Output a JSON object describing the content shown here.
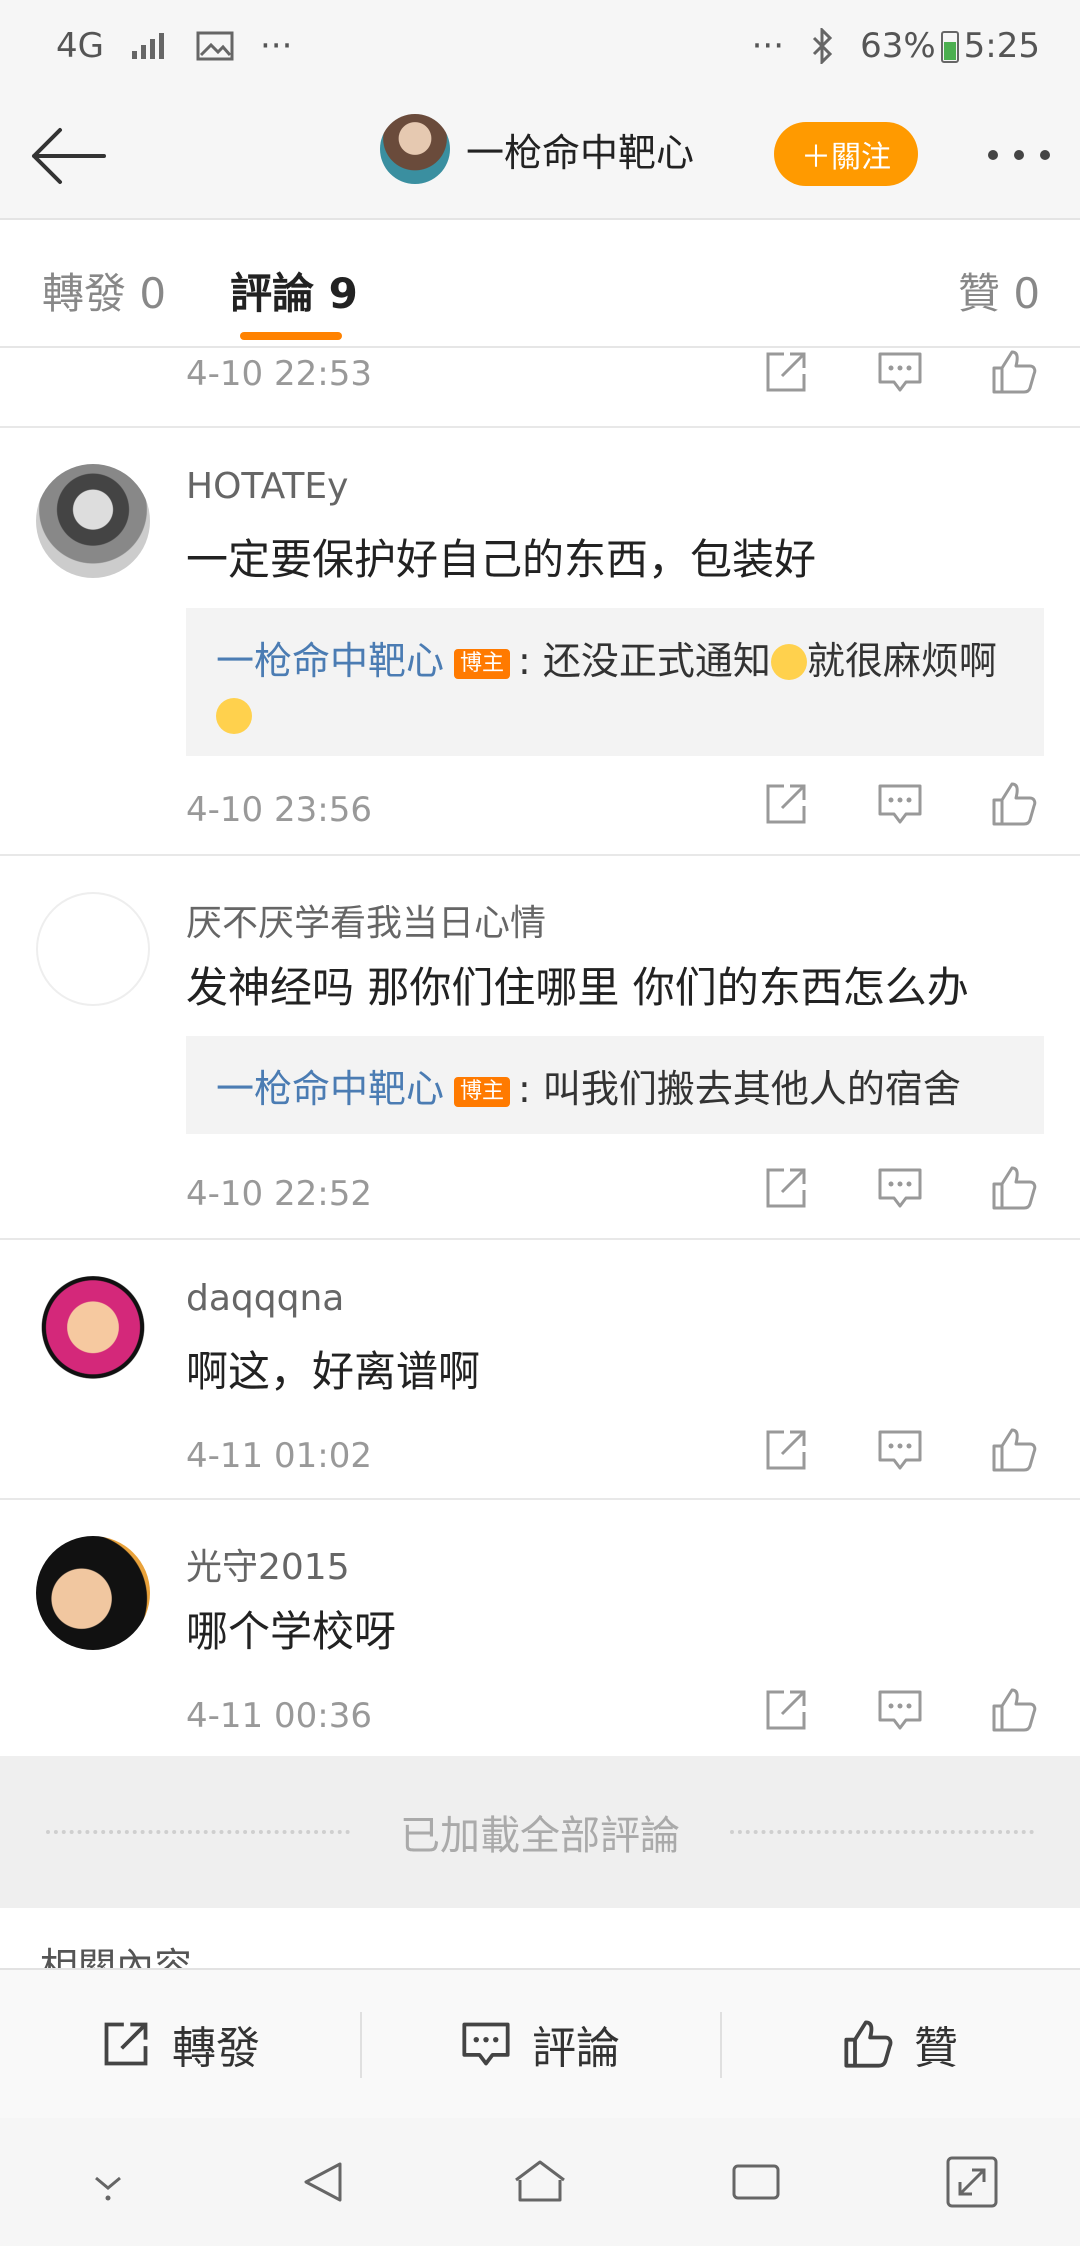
{
  "status": {
    "network": "4G",
    "signal_label": "signal",
    "dots_left": "···",
    "dots_right": "···",
    "battery": "63%",
    "time": "5:25"
  },
  "header": {
    "username": "一枪命中靶心",
    "follow_label": "＋關注"
  },
  "tabs": [
    {
      "label": "轉發",
      "count": "0"
    },
    {
      "label": "評論",
      "count": "9"
    },
    {
      "label": "贊",
      "count": "0"
    }
  ],
  "comments": [
    {
      "name": "",
      "text": "",
      "time": "4-10 22:53"
    },
    {
      "name": "HOTATEy",
      "text": "一定要保护好自己的东西，包装好",
      "reply_name": "一枪命中靶心",
      "reply_badge": "博主",
      "reply_text": ": 还没正式通知",
      "reply_text2": "就很麻烦啊",
      "time": "4-10 23:56"
    },
    {
      "name": "厌不厌学看我当日心情",
      "text": "发神经吗 那你们住哪里 你们的东西怎么办",
      "reply_name": "一枪命中靶心",
      "reply_badge": "博主",
      "reply_text": ": 叫我们搬去其他人的宿舍",
      "time": "4-10 22:52"
    },
    {
      "name": "daqqqna",
      "text": "啊这，好离谱啊",
      "time": "4-11 01:02"
    },
    {
      "name": "光守2015",
      "text": "哪个学校呀",
      "time": "4-11 00:36"
    }
  ],
  "footer": {
    "loaded_label": "已加載全部評論",
    "related_label": "相關內容"
  },
  "bottom_actions": {
    "repost": "轉發",
    "comment": "評論",
    "like": "贊"
  },
  "colors": {
    "accent": "#ff8200",
    "link": "#4b7cb3",
    "badge": "#ff7a00"
  }
}
